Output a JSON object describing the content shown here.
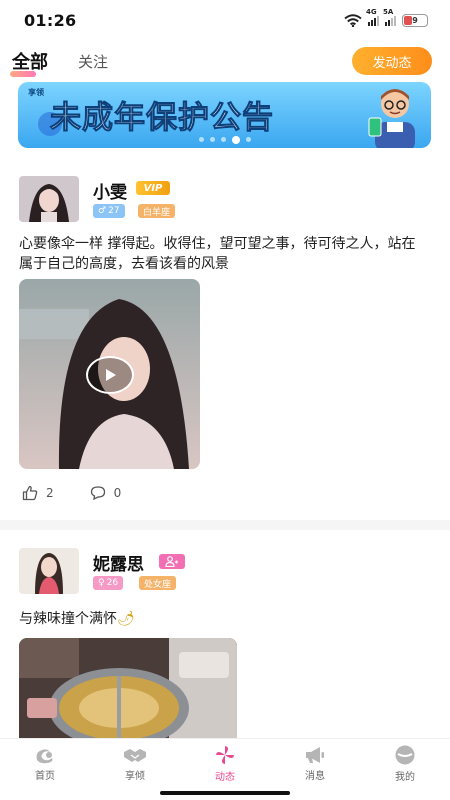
{
  "status_bar": {
    "time": "01:26",
    "signal_1_label": "4G",
    "signal_2_label": "5A",
    "battery": "9",
    "icons": [
      "wifi-icon",
      "signal-icon",
      "battery-icon"
    ]
  },
  "top_tabs": {
    "tabs": [
      {
        "label": "全部",
        "active": true
      },
      {
        "label": "关注",
        "active": false
      }
    ],
    "post_button_label": "发动态"
  },
  "banner": {
    "brand": "享领",
    "title": "未成年保护公告",
    "page_count": 5,
    "active_page": 4
  },
  "posts": [
    {
      "username": "小雯",
      "vip_label": "VIP",
      "gender": "male",
      "age": "27",
      "zodiac": "白羊座",
      "text": "心要像伞一样  撑得起。收得住，望可望之事，待可待之人，站在属于自己的高度，去看该看的风景",
      "media_type": "video",
      "likes": "2",
      "comments": "0"
    },
    {
      "username": "妮露思",
      "gender": "female",
      "age": "26",
      "zodiac": "处女座",
      "text": "与辣味撞个满怀",
      "media_type": "image"
    }
  ],
  "bottom_nav": {
    "items": [
      {
        "label": "首页",
        "icon": "home-icon"
      },
      {
        "label": "享倾",
        "icon": "handshake-icon"
      },
      {
        "label": "动态",
        "icon": "pinwheel-icon",
        "active": true
      },
      {
        "label": "消息",
        "icon": "megaphone-icon"
      },
      {
        "label": "我的",
        "icon": "profile-icon"
      }
    ]
  },
  "colors": {
    "accent_orange": "#ff9d20",
    "active_pink": "#e9488f",
    "vip_gold": "#f5b020",
    "banner_blue": "#3aa7f0"
  }
}
